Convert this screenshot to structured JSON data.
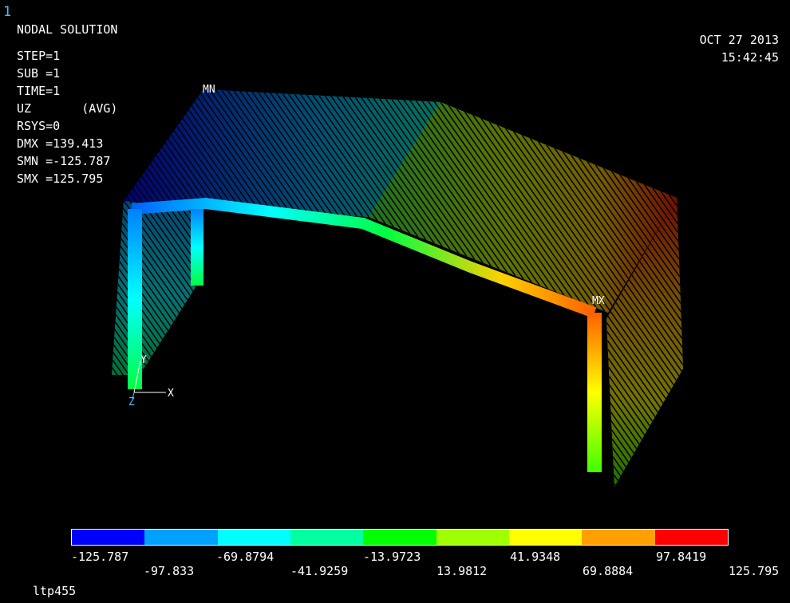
{
  "window_number": "1",
  "title": "NODAL SOLUTION",
  "info": [
    "STEP=1",
    "SUB =1",
    "TIME=1",
    "UZ       (AVG)",
    "RSYS=0",
    "DMX =139.413",
    "SMN =-125.787",
    "SMX =125.795"
  ],
  "date": "OCT 27 2013",
  "time": "15:42:45",
  "model_labels": {
    "min": "MN",
    "max": "MX",
    "axis_x": "X",
    "axis_y": "Y",
    "axis_z": "Z"
  },
  "legend": {
    "colors": [
      "#0000ff",
      "#00a0ff",
      "#00ffff",
      "#00ffa0",
      "#00ff00",
      "#a0ff00",
      "#ffff00",
      "#ffa000",
      "#ff0000"
    ],
    "values_top": [
      "-125.787",
      "-69.8794",
      "-13.9723",
      "41.9348",
      "97.8419"
    ],
    "values_bottom": [
      "-97.833",
      "-41.9259",
      "13.9812",
      "69.8884",
      "125.795"
    ]
  },
  "footer": "ltp455"
}
